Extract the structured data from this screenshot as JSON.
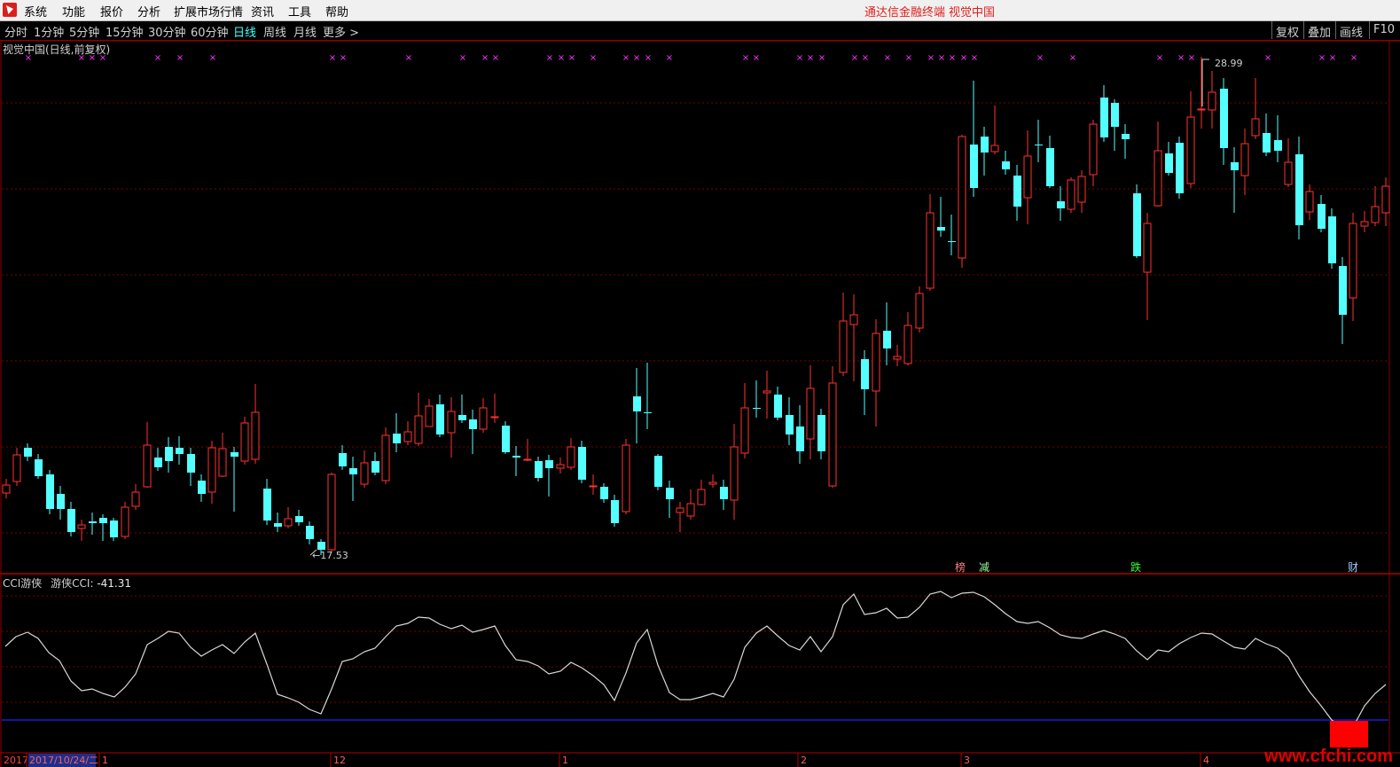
{
  "menubar": {
    "items": [
      "系统",
      "功能",
      "报价",
      "分析",
      "扩展市场行情",
      "资讯",
      "工具",
      "帮助"
    ],
    "brand_terminal": "通达信金融终端",
    "brand_stock": "视觉中国"
  },
  "toolbar": {
    "periods": [
      "分时",
      "1分钟",
      "5分钟",
      "15分钟",
      "30分钟",
      "60分钟",
      "日线",
      "周线",
      "月线",
      "更多 >"
    ],
    "active_period": "日线",
    "right_buttons": [
      "复权",
      "叠加",
      "画线",
      "F10"
    ]
  },
  "main_chart": {
    "title": "视觉中国(日线,前复权)",
    "high_label": "28.99",
    "low_label": "17.53",
    "markers": [
      {
        "text": "榜",
        "color": "#ff7f7f"
      },
      {
        "text": "减",
        "color": "#9aff9a"
      },
      {
        "text": "跌",
        "color": "#33ff33"
      },
      {
        "text": "财",
        "color": "#a0c8ff"
      }
    ],
    "up_color": "#ff3232",
    "down_color": "#54ffff"
  },
  "indicator": {
    "name": "CCI游侠",
    "label": "游侠CCI:",
    "value": "-41.31",
    "line_color": "#d8d8d8"
  },
  "date_axis": {
    "labels": [
      "2017",
      "2017/10/24/二",
      "1",
      "12",
      "1",
      "2",
      "3",
      "4"
    ]
  },
  "watermark": "www.cfchi.com"
}
